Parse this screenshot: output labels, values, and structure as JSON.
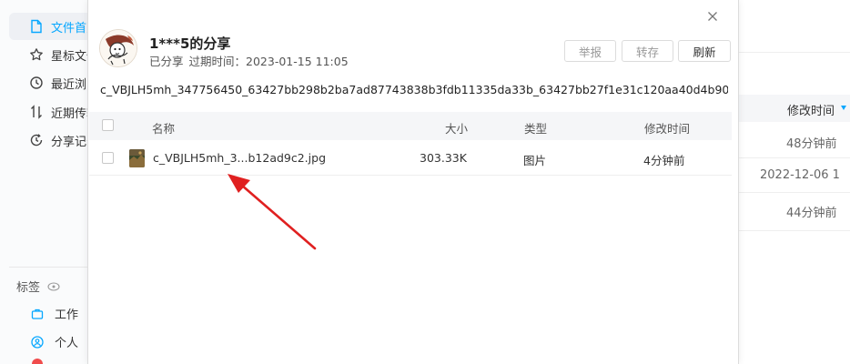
{
  "sidebar": {
    "items": [
      {
        "label": "文件首页",
        "icon": "file-icon",
        "active": true
      },
      {
        "label": "星标文件",
        "icon": "star-icon",
        "active": false
      },
      {
        "label": "最近浏览",
        "icon": "history-icon",
        "active": false
      },
      {
        "label": "近期传输",
        "icon": "transfer-icon",
        "active": false
      },
      {
        "label": "分享记录",
        "icon": "share-history-icon",
        "active": false
      }
    ],
    "tags_label": "标签",
    "tags": [
      {
        "label": "工作",
        "icon": "briefcase-icon"
      },
      {
        "label": "个人",
        "icon": "person-icon"
      }
    ]
  },
  "background_table": {
    "column_header": "修改时间",
    "rows": [
      "48分钟前",
      "2022-12-06 1",
      "44分钟前"
    ]
  },
  "dialog": {
    "title": "1***5的分享",
    "status": "已分享",
    "expiry_label": "过期时间：",
    "expiry_value": "2023-01-15 11:05",
    "buttons": {
      "report": "举报",
      "save": "转存",
      "refresh": "刷新"
    },
    "share_link": "c_VBJLH5mh_347756450_63427bb298b2ba7ad87743838b3fdb11335da33b_63427bb27f1e31c120aa40d4b90...",
    "columns": {
      "name": "名称",
      "size": "大小",
      "type": "类型",
      "modified": "修改时间"
    },
    "files": [
      {
        "name": "c_VBJLH5mh_3...b12ad9c2.jpg",
        "size": "303.33K",
        "type": "图片",
        "modified": "4分钟前"
      }
    ]
  },
  "colors": {
    "accent": "#06a7ff",
    "arrow": "#e02020",
    "active_nav_bg": "#eef0f4"
  }
}
